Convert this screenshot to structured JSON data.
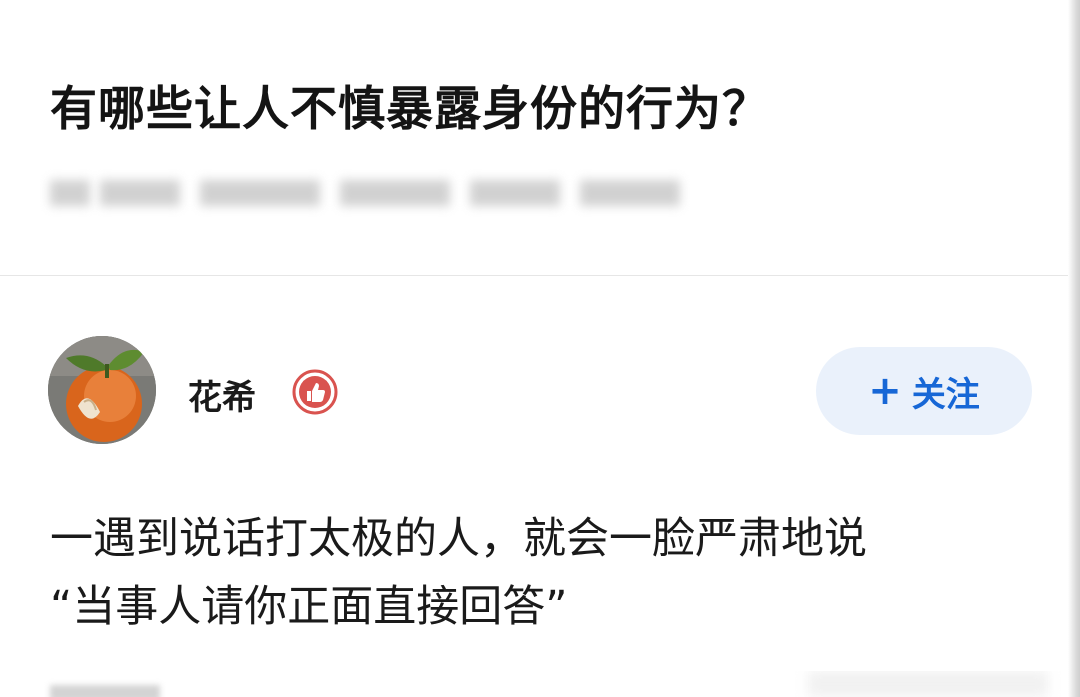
{
  "question": {
    "title": "有哪些让人不慎暴露身份的行为？"
  },
  "author": {
    "name": "花希"
  },
  "follow_button": {
    "plus": "+",
    "label": "关注"
  },
  "answer": {
    "lines": [
      "一遇到说话打太极的人，就会一脸严肃地说",
      "“当事人请你正面直接回答”"
    ]
  },
  "colors": {
    "accent": "#1767d6",
    "follow_bg": "#eaf1fb",
    "badge_red": "#d9534f"
  },
  "icons": {
    "badge": "thumbs-up-badge-icon",
    "avatar": "orange-fruit-avatar"
  }
}
